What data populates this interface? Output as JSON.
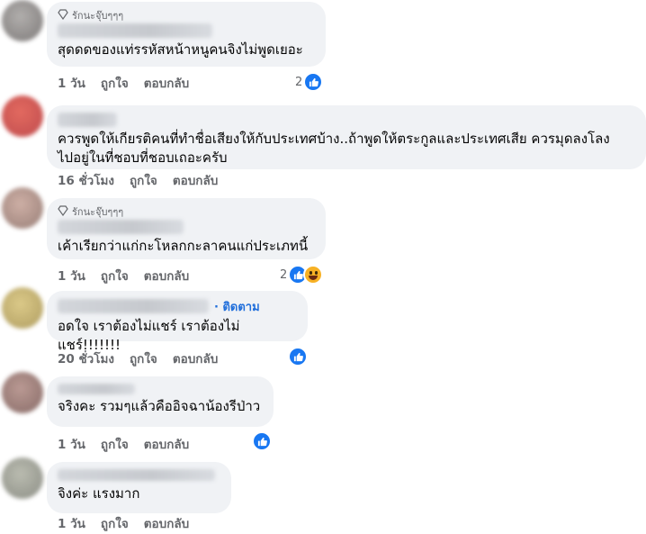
{
  "comments": [
    {
      "badge": "รักนะจุ๊บๆๆๆ",
      "text": "สุดดดของแท่รรหัสหน้าหนูคนจิงไม่พูดเยอะ",
      "time": "1 วัน",
      "like_label": "ถูกใจ",
      "reply_label": "ตอบกลับ",
      "reaction_count": "2"
    },
    {
      "text_lines": [
        "ควรพูดให้เกียรติคนที่ทำชื่อเสียงให้กับประเทศบ้าง..ถ้าพูดให้ตระกูลและประเทศเสีย ควรมุดลงโลง",
        "ไปอยู่ในที่ชอบที่ชอบเถอะครับ"
      ],
      "time": "16 ชั่วโมง",
      "like_label": "ถูกใจ",
      "reply_label": "ตอบกลับ"
    },
    {
      "badge": "รักนะจุ๊บๆๆๆ",
      "text": "เค้าเรียกว่าแก่กะโหลกกะลาคนแก่ประเภทนี้",
      "time": "1 วัน",
      "like_label": "ถูกใจ",
      "reply_label": "ตอบกลับ",
      "reaction_count": "2"
    },
    {
      "follow_label": "· ติดตาม",
      "text": "อดใจ เราต้องไม่แชร์ เราต้องไม่แชร์!!!!!!!",
      "time": "20 ชั่วโมง",
      "like_label": "ถูกใจ",
      "reply_label": "ตอบกลับ"
    },
    {
      "text": "จริงคะ รวมๆแล้วคืออิจฉาน้องรีป่าว",
      "time": "1 วัน",
      "like_label": "ถูกใจ",
      "reply_label": "ตอบกลับ"
    },
    {
      "text": "จิงค่ะ แรงมาก",
      "time": "1 วัน",
      "like_label": "ถูกใจ",
      "reply_label": "ตอบกลับ"
    }
  ],
  "colors": {
    "bubble": "#f0f2f5",
    "like_blue": "#1877f2",
    "follow_blue": "#216fdb",
    "meta_gray": "#65676b"
  }
}
